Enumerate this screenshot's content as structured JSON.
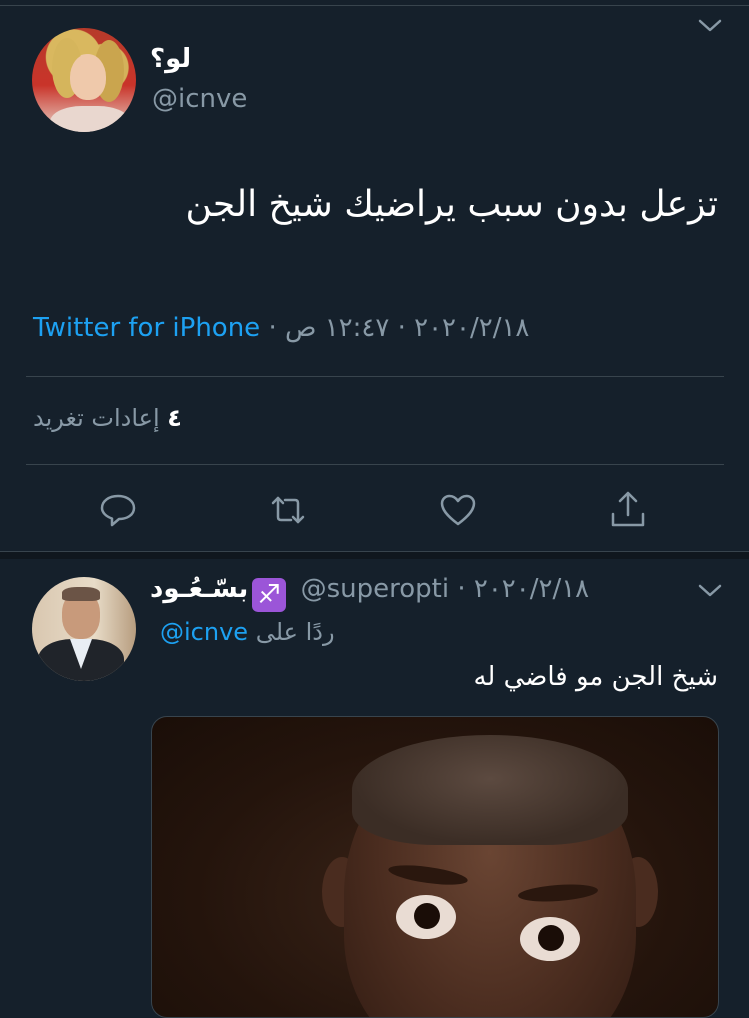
{
  "tweet": {
    "author_name": "لو؟",
    "author_handle": "@icnve",
    "text": "تزعل بدون سبب يراضيك شيخ الجن",
    "time": "١٢:٤٧ ص",
    "separator": "·",
    "date": "٢٠٢٠/٢/١٨",
    "source": "Twitter for iPhone",
    "retweet_count": "٤",
    "retweet_label": "إعادات تغريد"
  },
  "reply": {
    "author_name": "بسّـعُـود",
    "zodiac_icon": "♐",
    "author_handle": "@superopti",
    "separator": "·",
    "date": "٢٠٢٠/٢/١٨",
    "replying_label": "ردًا على",
    "replying_handle": "@icnve",
    "text": "شيخ الجن مو فاضي له",
    "media": "reaction image of a surprised man"
  },
  "icons": [
    "chevron-down-icon",
    "reply-icon",
    "retweet-icon",
    "like-icon",
    "share-icon"
  ],
  "colors": {
    "background": "#15202b",
    "text": "#ffffff",
    "secondary": "#8899a6",
    "accent": "#1da1f2",
    "divider": "#38444d",
    "zodiac_badge": "#9b55d8"
  }
}
